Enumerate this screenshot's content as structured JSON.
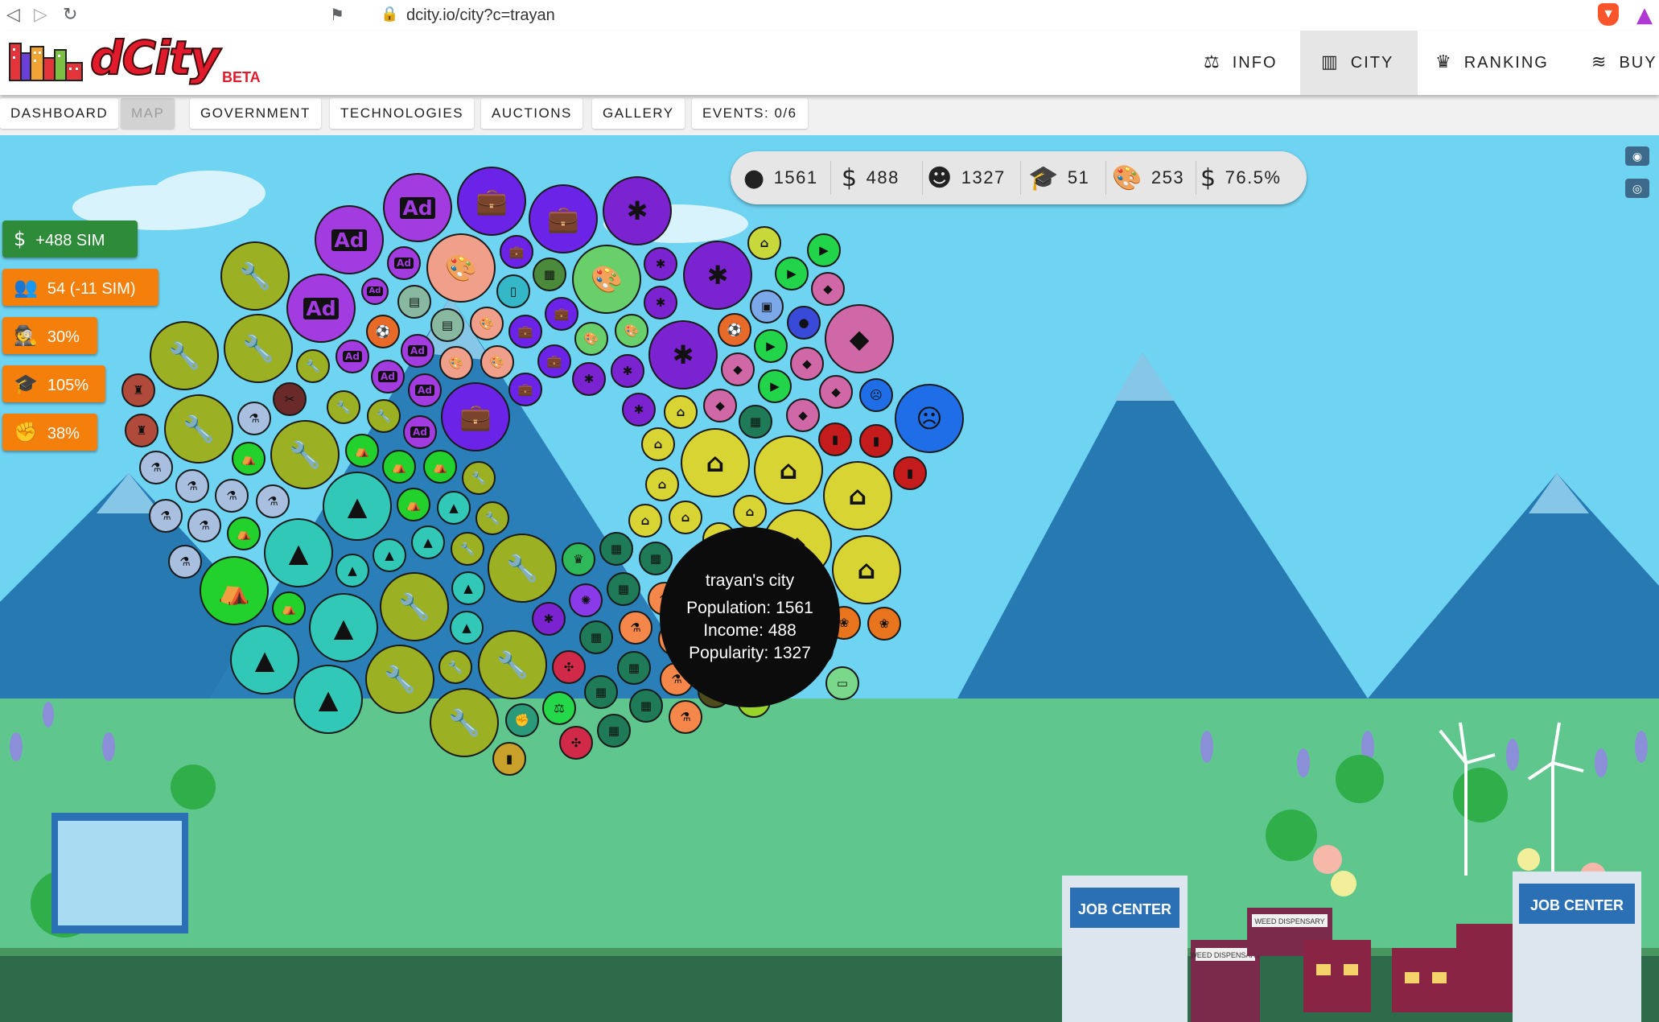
{
  "browser": {
    "url": "dcity.io/city?c=trayan"
  },
  "header": {
    "logo_text": "dCity",
    "logo_badge": "BETA",
    "nav": [
      {
        "label": "INFO",
        "icon": "balance-scale-icon"
      },
      {
        "label": "CITY",
        "icon": "city-icon",
        "active": true
      },
      {
        "label": "RANKING",
        "icon": "trophy-icon"
      },
      {
        "label": "BUY",
        "icon": "layers-icon"
      }
    ]
  },
  "tabs": [
    "DASHBOARD",
    "MAP",
    "GOVERNMENT",
    "TECHNOLOGIES",
    "AUCTIONS",
    "GALLERY",
    "EVENTS: 0/6"
  ],
  "active_tab": "MAP",
  "stats": [
    {
      "icon": "user-icon",
      "value": "1561"
    },
    {
      "icon": "dollar-icon",
      "value": "488"
    },
    {
      "icon": "smile-icon",
      "value": "1327"
    },
    {
      "icon": "graduation-cap-icon",
      "value": "51"
    },
    {
      "icon": "palette-icon",
      "value": "253"
    },
    {
      "icon": "hand-money-icon",
      "value": "76.5%"
    }
  ],
  "side_badges": [
    {
      "icon": "dollar-icon",
      "label": "+488 SIM",
      "color": "#2e8b3a"
    },
    {
      "icon": "users-icon",
      "label": "54 (-11 SIM)",
      "color": "#f57f0b"
    },
    {
      "icon": "spy-icon",
      "label": "30%",
      "color": "#f57f0b"
    },
    {
      "icon": "graduate-icon",
      "label": "105%",
      "color": "#f57f0b"
    },
    {
      "icon": "fist-icon",
      "label": "38%",
      "color": "#f57f0b"
    }
  ],
  "city_bubble": {
    "title": "trayan's city",
    "population": "Population: 1561",
    "income": "Income: 488",
    "popularity": "Popularity: 1327"
  },
  "scene_labels": [
    "JOB CENTER",
    "JOB CENTER",
    "WEED DISPENSARY",
    "WEED DISPENSARY"
  ],
  "colors": {
    "wrench": "#9cb024",
    "ad": "#a23be0",
    "briefcase": "#6b23e8",
    "weed": "#7b22d1",
    "palette": "#f0a08a",
    "palette_green": "#68cf6a",
    "tree": "#31c8b8",
    "tent": "#22d12c",
    "lab": "#a8bfe0",
    "house": "#d8d434",
    "video": "#22d44a",
    "spy": "#d068a8",
    "gym": "#c41c1c",
    "sad": "#1f6ee8",
    "building": "#1e7a57",
    "flask_orange": "#f5874a",
    "tractor": "#4e4c1c",
    "hotel": "#98d42a"
  }
}
